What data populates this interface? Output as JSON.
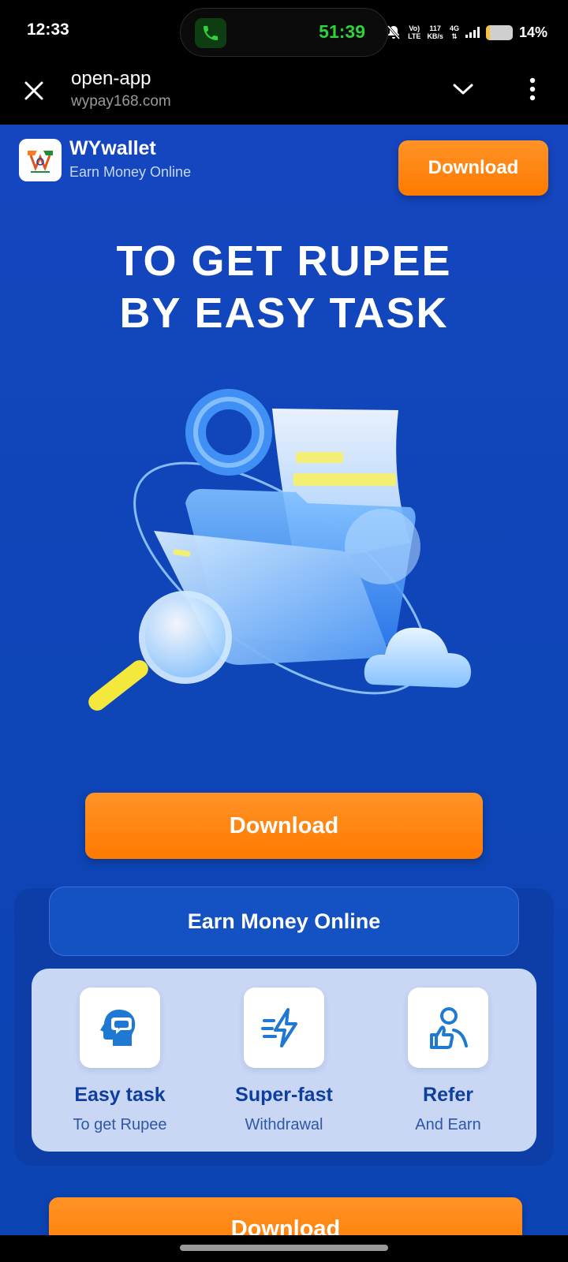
{
  "status_bar": {
    "time": "12:33",
    "call_timer": "51:39",
    "network_top": "Vo)",
    "network_bottom": "LTE",
    "speed_top": "117",
    "speed_bottom": "KB/s",
    "net_type": "4G",
    "battery_percent_text": "14%",
    "battery_level": 0.14
  },
  "browser": {
    "title": "open-app",
    "domain": "wypay168.com"
  },
  "app_header": {
    "name": "WYwallet",
    "subtitle": "Earn Money Online",
    "download_label": "Download"
  },
  "hero": {
    "headline_line1": "TO GET RUPEE",
    "headline_line2": "BY EASY TASK"
  },
  "main_download_label": "Download",
  "features": {
    "title": "Earn Money Online",
    "items": [
      {
        "title": "Easy task",
        "subtitle": "To get Rupee",
        "icon": "head-chat-icon"
      },
      {
        "title": "Super-fast",
        "subtitle": "Withdrawal",
        "icon": "lightning-icon"
      },
      {
        "title": "Refer",
        "subtitle": "And Earn",
        "icon": "user-thumbs-up-icon"
      }
    ]
  },
  "bottom_download_label": "Download",
  "colors": {
    "page_blue": "#1546c0",
    "orange": "#ff7a00",
    "feature_card": "#c9d7f5",
    "feature_text": "#0f3f9e"
  }
}
